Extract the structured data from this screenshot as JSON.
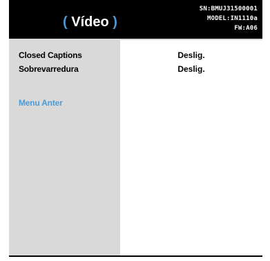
{
  "header": {
    "title_open": "(",
    "title": " Vídeo ",
    "title_close": ")",
    "serial": "SN:BMUJ31500001",
    "model": "MODEL:IN1110a",
    "firmware": "FW:A06"
  },
  "menu": {
    "items": [
      {
        "label": "Closed Captions",
        "value": "Deslig."
      },
      {
        "label": "Sobrevarredura",
        "value": "Deslig."
      }
    ],
    "back_label": "Menu Anter"
  },
  "colors": {
    "header_bg": "#000000",
    "accent": "#4a9bd8",
    "panel_bg": "#d9d9d9",
    "value_bg": "#ffffff"
  }
}
